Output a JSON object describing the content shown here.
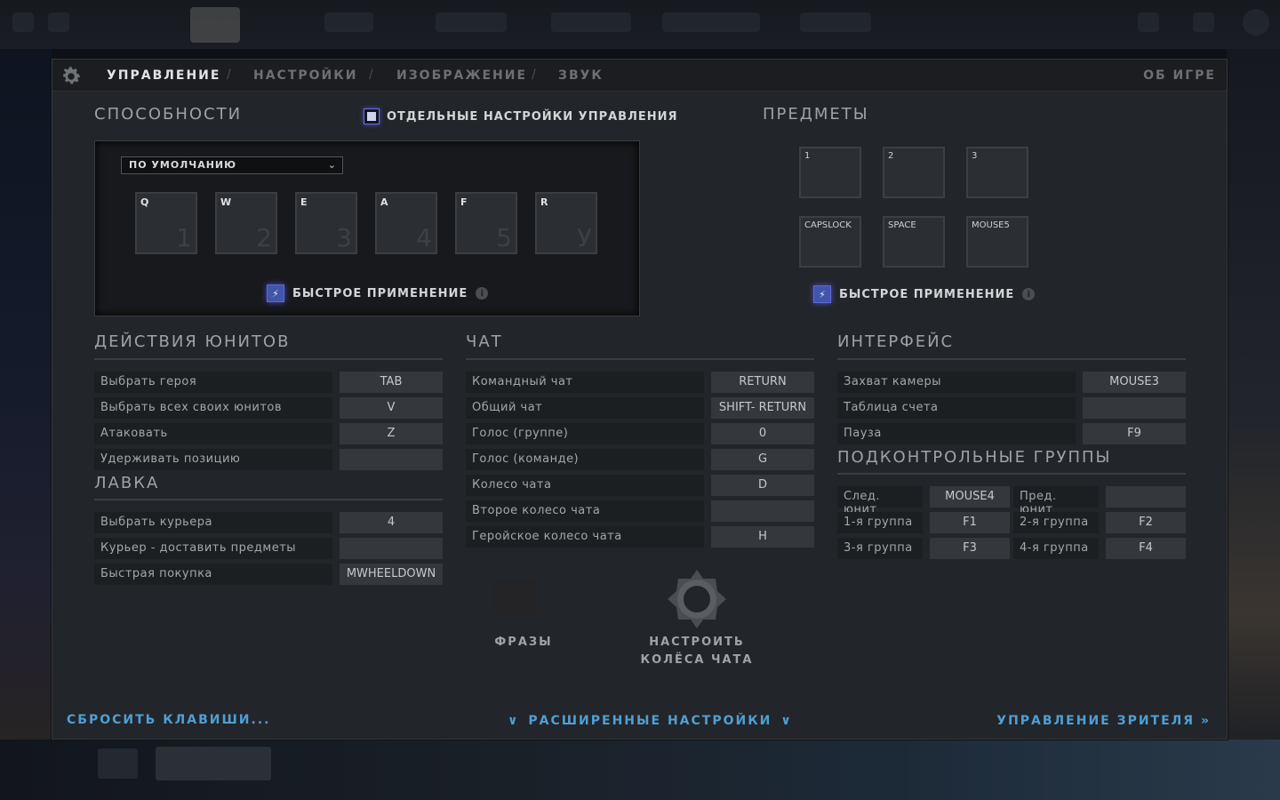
{
  "tabs": {
    "controls": "УПРАВЛЕНИЕ",
    "settings": "НАСТРОЙКИ",
    "video": "ИЗОБРАЖЕНИЕ",
    "sound": "ЗВУК",
    "separator": "/",
    "about": "ОБ ИГРЕ"
  },
  "abilities": {
    "title": "СПОСОБНОСТИ",
    "separate_controls_label": "ОТДЕЛЬНЫЕ НАСТРОЙКИ УПРАВЛЕНИЯ",
    "preset": "ПО УМОЛЧАНИЮ",
    "keys": [
      {
        "key": "Q",
        "slot": "1"
      },
      {
        "key": "W",
        "slot": "2"
      },
      {
        "key": "E",
        "slot": "3"
      },
      {
        "key": "A",
        "slot": "4"
      },
      {
        "key": "F",
        "slot": "5"
      },
      {
        "key": "R",
        "slot": "У"
      }
    ],
    "quick_cast": "БЫСТРОЕ ПРИМЕНЕНИЕ"
  },
  "items": {
    "title": "ПРЕДМЕТЫ",
    "keys": [
      "1",
      "2",
      "3",
      "CAPSLOCK",
      "SPACE",
      "MOUSE5"
    ],
    "quick_cast": "БЫСТРОЕ ПРИМЕНЕНИЕ"
  },
  "unit_actions": {
    "title": "ДЕЙСТВИЯ ЮНИТОВ",
    "rows": [
      {
        "label": "Выбрать героя",
        "value": "TAB"
      },
      {
        "label": "Выбрать всех своих юнитов",
        "value": "V"
      },
      {
        "label": "Атаковать",
        "value": "Z"
      },
      {
        "label": "Удерживать позицию",
        "value": ""
      }
    ]
  },
  "shop": {
    "title": "ЛАВКА",
    "rows": [
      {
        "label": "Выбрать курьера",
        "value": "4"
      },
      {
        "label": "Курьер - доставить предметы",
        "value": ""
      },
      {
        "label": "Быстрая покупка",
        "value": "MWHEELDOWN"
      }
    ]
  },
  "chat": {
    "title": "ЧАТ",
    "rows": [
      {
        "label": "Командный чат",
        "value": "RETURN"
      },
      {
        "label": "Общий чат",
        "value": "SHIFT- RETURN"
      },
      {
        "label": "Голос (группе)",
        "value": "0"
      },
      {
        "label": "Голос (команде)",
        "value": "G"
      },
      {
        "label": "Колесо чата",
        "value": "D"
      },
      {
        "label": "Второе колесо чата",
        "value": ""
      },
      {
        "label": "Геройское колесо чата",
        "value": "H"
      }
    ],
    "phrases": "ФРАЗЫ",
    "wheel_config_line1": "НАСТРОИТЬ",
    "wheel_config_line2": "КОЛЁСА ЧАТА"
  },
  "interface": {
    "title": "ИНТЕРФЕЙС",
    "rows": [
      {
        "label": "Захват камеры",
        "value": "MOUSE3"
      },
      {
        "label": "Таблица счета",
        "value": ""
      },
      {
        "label": "Пауза",
        "value": "F9"
      }
    ]
  },
  "control_groups": {
    "title": "ПОДКОНТРОЛЬНЫЕ ГРУППЫ",
    "rows": [
      [
        {
          "label": "След. юнит",
          "value": "MOUSE4"
        },
        {
          "label": "Пред. юнит",
          "value": ""
        }
      ],
      [
        {
          "label": "1-я группа",
          "value": "F1"
        },
        {
          "label": "2-я группа",
          "value": "F2"
        }
      ],
      [
        {
          "label": "3-я группа",
          "value": "F3"
        },
        {
          "label": "4-я группа",
          "value": "F4"
        }
      ]
    ]
  },
  "footer": {
    "reset": "СБРОСИТЬ КЛАВИШИ...",
    "advanced": "РАСШИРЕННЫЕ НАСТРОЙКИ",
    "spectator": "УПРАВЛЕНИЕ ЗРИТЕЛЯ"
  },
  "colors": {
    "accent_blue": "#4f9fd4",
    "panel_bg": "#222529",
    "checkbox_glow": "#4c50c8"
  }
}
